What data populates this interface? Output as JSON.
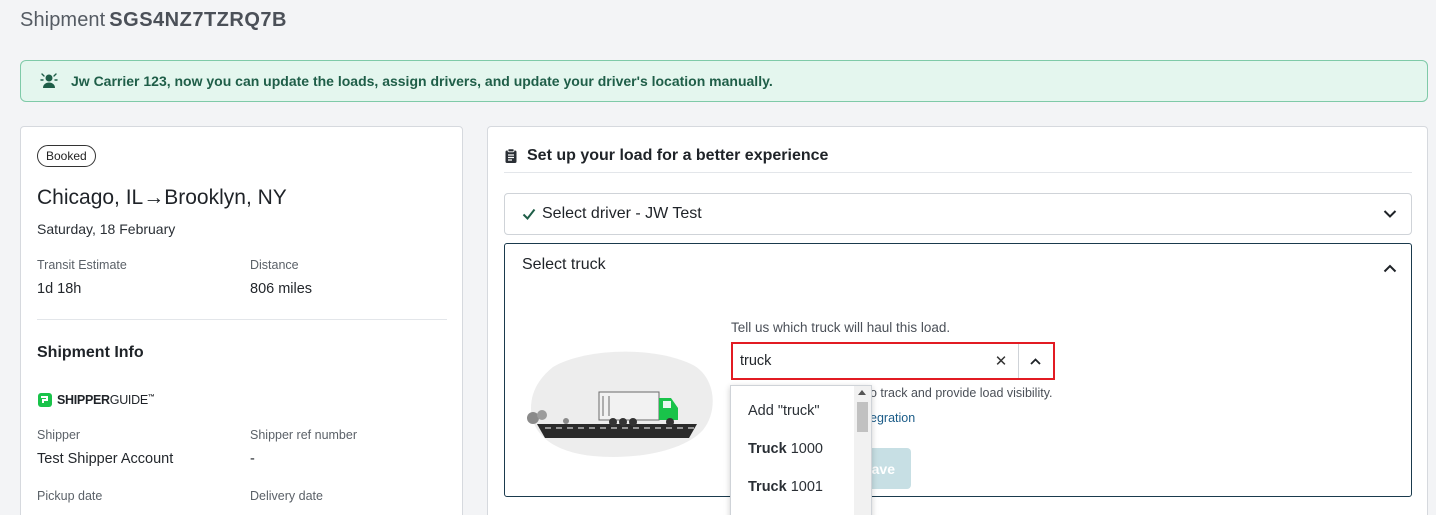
{
  "page": {
    "title_prefix": "Shipment",
    "shipment_id": "SGS4NZ7TZRQ7B"
  },
  "banner": {
    "icon": "driver-icon",
    "text": "Jw Carrier 123, now you can update the loads, assign drivers, and update your driver's location manually."
  },
  "summary": {
    "status": "Booked",
    "origin": "Chicago, IL",
    "arrow": "→",
    "destination": "Brooklyn, NY",
    "date": "Saturday, 18 February",
    "transit_label": "Transit Estimate",
    "transit_value": "1d 18h",
    "distance_label": "Distance",
    "distance_value": "806 miles"
  },
  "shipment_info": {
    "title": "Shipment Info",
    "logo_bold": "SHIPPER",
    "logo_light": "GUIDE",
    "logo_tm": "™",
    "shipper_label": "Shipper",
    "shipper_value": "Test Shipper Account",
    "ref_label": "Shipper ref number",
    "ref_value": "-",
    "pickup_label": "Pickup date",
    "delivery_label": "Delivery date"
  },
  "setup": {
    "title": "Set up your load for a better experience",
    "driver_label": "Select driver - JW Test",
    "truck_label": "Select truck",
    "prompt": "Tell us which truck will haul this load.",
    "input_value": "truck",
    "helper_text": "o track and provide load visibility.",
    "integration_link": "egration",
    "save_label": "ave"
  },
  "dropdown": {
    "options": [
      {
        "prefix": "",
        "bold": "",
        "text": "Add \"truck\""
      },
      {
        "prefix": "",
        "bold": "Truck",
        "text": " 1000"
      },
      {
        "prefix": "",
        "bold": "Truck",
        "text": " 1001"
      }
    ]
  },
  "colors": {
    "accent": "#1a3a4d",
    "banner_bg": "#e4f6ee",
    "banner_border": "#7fcaa8",
    "highlight": "#e21b23",
    "brand_green": "#19c34a"
  }
}
